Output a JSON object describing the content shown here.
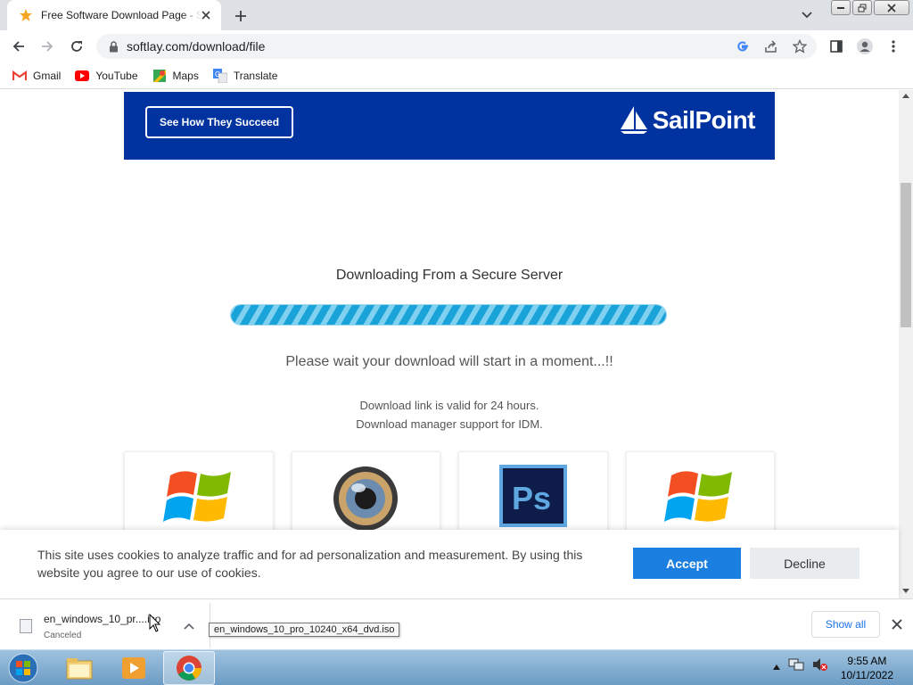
{
  "browser": {
    "tab_title": "Free Software Download Page - Softlay",
    "url": "softlay.com/download/file",
    "bookmarks": [
      {
        "label": "Gmail",
        "icon": "gmail-icon"
      },
      {
        "label": "YouTube",
        "icon": "youtube-icon"
      },
      {
        "label": "Maps",
        "icon": "maps-icon"
      },
      {
        "label": "Translate",
        "icon": "translate-icon"
      }
    ]
  },
  "page": {
    "ad": {
      "button_label": "See How They Succeed",
      "brand": "SailPoint",
      "color": "#0033a0"
    },
    "download_title": "Downloading From a Secure Server",
    "wait_message": "Please wait your download will start in a moment...!!",
    "info_lines": [
      "Download link is valid for 24 hours.",
      "Download manager support for IDM."
    ],
    "progress_fraction": 1.0,
    "cards": [
      {
        "icon": "windows-logo-icon"
      },
      {
        "icon": "media-player-icon"
      },
      {
        "icon": "photoshop-icon",
        "label": "Ps"
      },
      {
        "icon": "windows-logo-icon"
      }
    ]
  },
  "cookie": {
    "text": "This site uses cookies to analyze traffic and for ad personalization and measurement. By using this website you agree to our use of cookies.",
    "accept_label": "Accept",
    "decline_label": "Decline",
    "accept_color": "#1a7fe0"
  },
  "download_shelf": {
    "item_name": "en_windows_10_pr....iso",
    "item_status": "Canceled",
    "tooltip": "en_windows_10_pro_10240_x64_dvd.iso",
    "show_all_label": "Show all"
  },
  "taskbar": {
    "time": "9:55 AM",
    "date": "10/11/2022"
  }
}
